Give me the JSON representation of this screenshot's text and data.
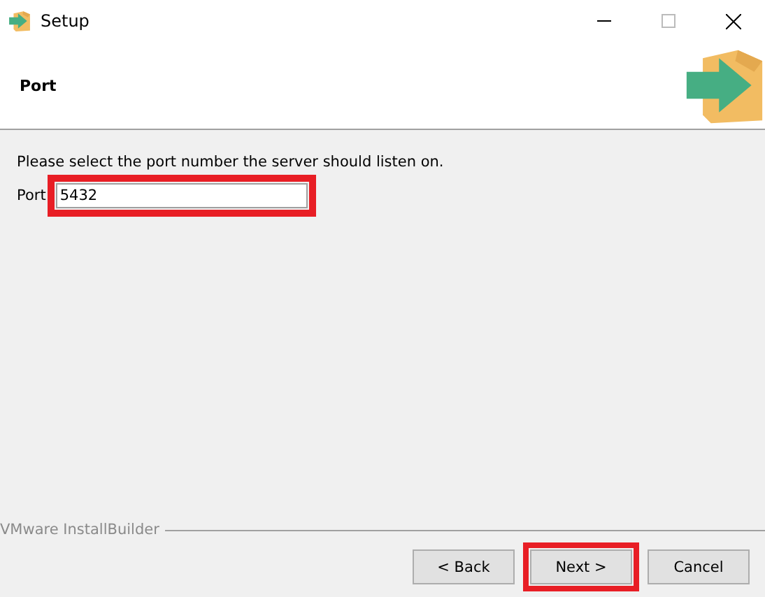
{
  "window": {
    "title": "Setup"
  },
  "header": {
    "title": "Port"
  },
  "description": "Please select the port number the server should listen on.",
  "port_field": {
    "label": "Port",
    "value": "5432",
    "highlighted": true
  },
  "footer": {
    "brand": "VMware InstallBuilder"
  },
  "buttons": [
    {
      "label": "< Back",
      "highlighted": false
    },
    {
      "label": "Next >",
      "highlighted": true
    },
    {
      "label": "Cancel",
      "highlighted": false
    }
  ]
}
